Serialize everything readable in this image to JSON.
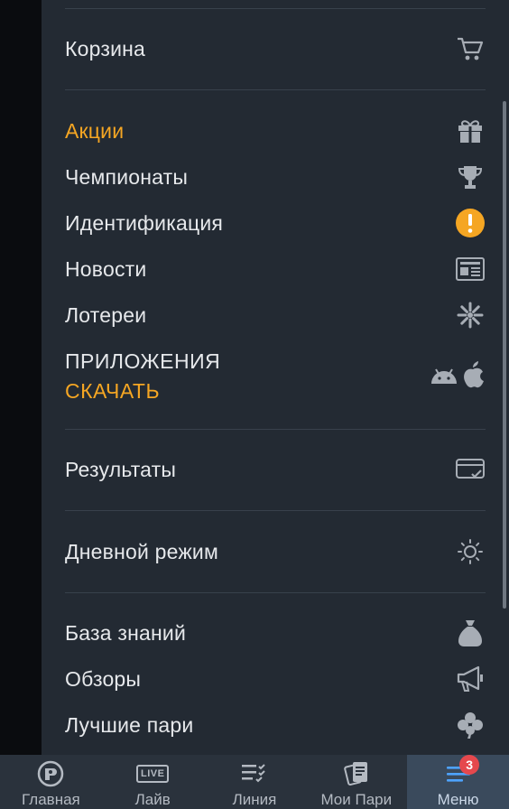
{
  "menu": {
    "cart": {
      "label": "Корзина",
      "icon": "cart-icon"
    },
    "promotions": {
      "label": "Акции",
      "icon": "gift-icon"
    },
    "championships": {
      "label": "Чемпионаты",
      "icon": "trophy-icon"
    },
    "identification": {
      "label": "Идентификация",
      "icon": "alert-icon"
    },
    "news": {
      "label": "Новости",
      "icon": "newspaper-icon"
    },
    "lotteries": {
      "label": "Лотереи",
      "icon": "lottery-icon"
    },
    "apps": {
      "title": "ПРИЛОЖЕНИЯ",
      "subtitle": "СКАЧАТЬ",
      "icons": [
        "android-icon",
        "apple-icon"
      ]
    },
    "results": {
      "label": "Результаты",
      "icon": "results-card-icon"
    },
    "day_mode": {
      "label": "Дневной режим",
      "icon": "sun-icon"
    },
    "knowledge_base": {
      "label": "База знаний",
      "icon": "money-bag-icon"
    },
    "reviews": {
      "label": "Обзоры",
      "icon": "megaphone-icon"
    },
    "best_bets": {
      "label": "Лучшие пари",
      "icon": "clover-icon"
    }
  },
  "bottom_nav": {
    "home": {
      "label": "Главная",
      "icon": "home-logo-icon"
    },
    "live": {
      "label": "Лайв",
      "icon_text": "LIVE"
    },
    "line": {
      "label": "Линия",
      "icon": "line-list-icon"
    },
    "my_bets": {
      "label": "Мои Пари",
      "icon": "coupon-icon"
    },
    "menu": {
      "label": "Меню",
      "icon": "menu-icon",
      "badge": "3",
      "active": true
    }
  },
  "colors": {
    "accent": "#f5a623",
    "background": "#232a33",
    "alert": "#f5a623",
    "badge": "#e5484d",
    "active_tab": "#3a4a5c"
  }
}
